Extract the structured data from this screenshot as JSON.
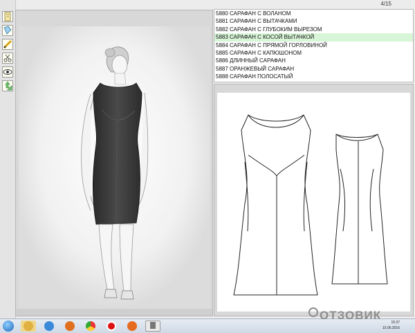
{
  "toolbar": {
    "tools": [
      {
        "icon": "document-icon",
        "color": "#f3e7a8"
      },
      {
        "icon": "pattern-pieces-icon",
        "color": "#9fd0ef"
      },
      {
        "icon": "pencil-icon",
        "color": "#f1d36a"
      },
      {
        "icon": "scissors-icon",
        "color": "#f4f0e8"
      },
      {
        "icon": "eye-icon",
        "color": "#7a7a7a"
      },
      {
        "icon": "cursor-arrows-icon",
        "color": "#6fc36f"
      }
    ]
  },
  "header": {
    "page_counter": "4/15"
  },
  "list": {
    "items": [
      "5880 САРАФАН С ВОЛАНОМ",
      "5881 САРАФАН С ВЫТАЧКАМИ",
      "5882 САРАФАН С ГЛУБОКИМ ВЫРЕЗОМ",
      "5883 САРАФАН С КОСОЙ ВЫТАЧКОЙ",
      "5884 САРАФАН С ПРЯМОЙ ГОРЛОВИНОЙ",
      "5885 САРАФАН С КАПЮШОНОМ",
      "5886 ДЛИННЫЙ САРАФАН",
      "5887 ОРАНЖЕВЫЙ САРАФАН",
      "5888 САРАФАН ПОЛОСАТЫЙ"
    ],
    "selected_index": 3,
    "selected_color": "#d8f5d8"
  },
  "taskbar": {
    "icons": [
      "explorer-icon",
      "internet-explorer-icon",
      "media-player-icon",
      "chrome-icon",
      "opera-icon",
      "firefox-icon",
      "pattern-app-icon"
    ],
    "time": "15:37",
    "date": "15.06.2016"
  },
  "watermark": {
    "text": "ОТЗОВИК"
  }
}
